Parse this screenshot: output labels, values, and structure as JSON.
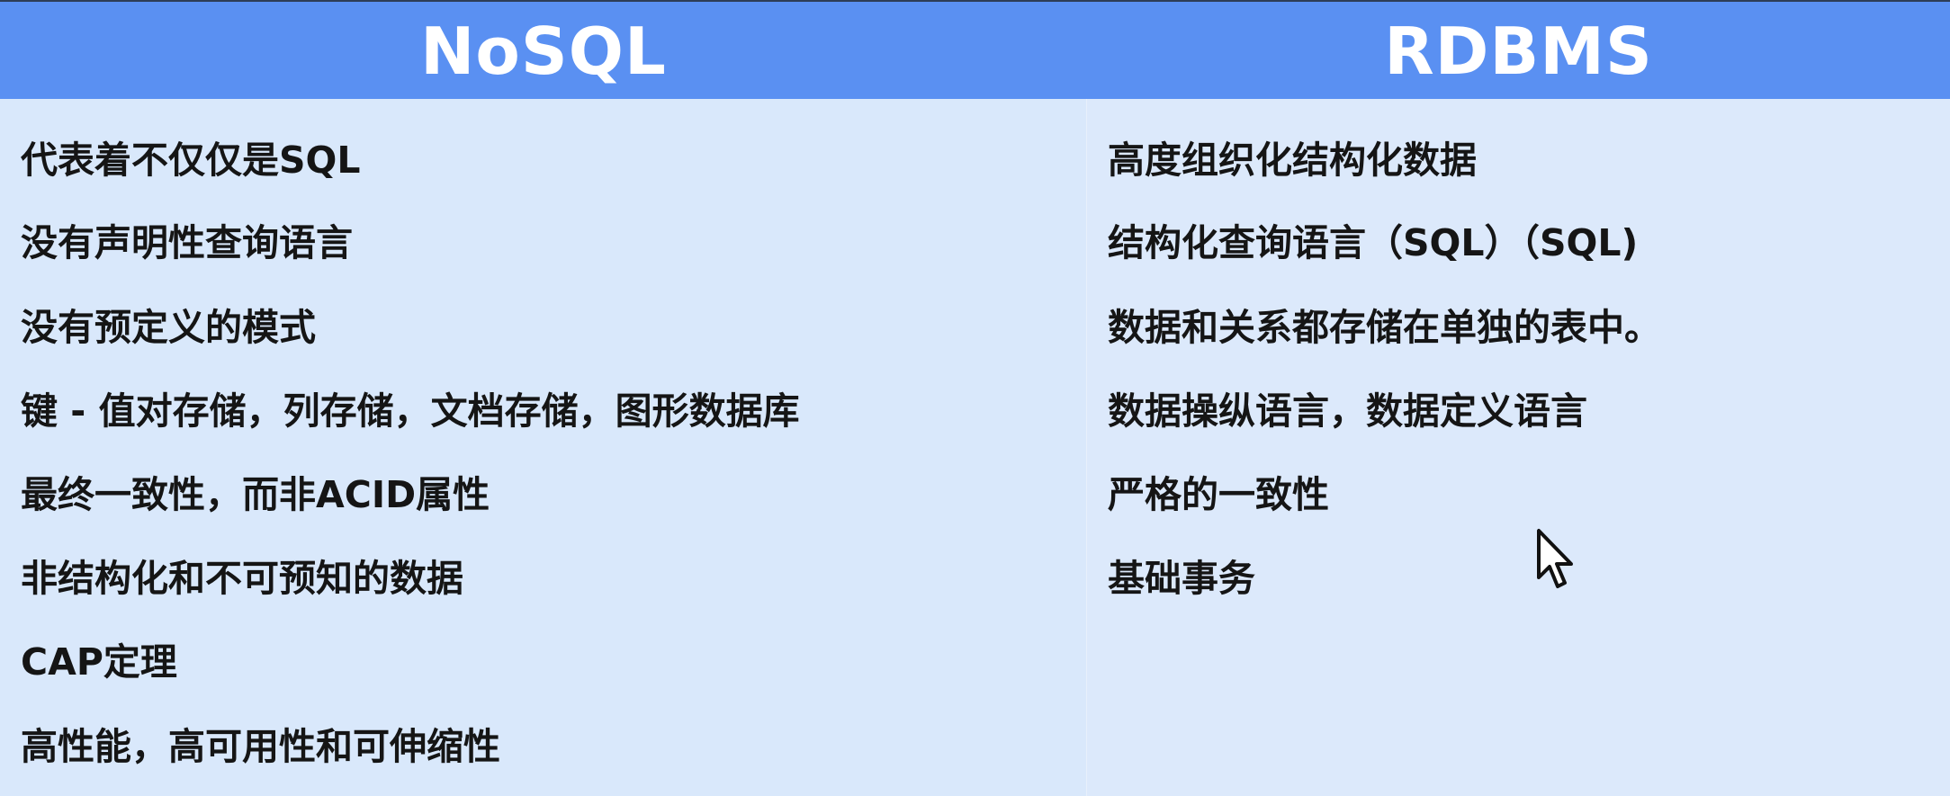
{
  "table": {
    "headers": {
      "left": "NoSQL",
      "right": "RDBMS"
    },
    "nosql_items": [
      "代表着不仅仅是SQL",
      "没有声明性查询语言",
      "没有预定义的模式",
      "键 - 值对存储，列存储，文档存储，图形数据库",
      "最终一致性，而非ACID属性",
      "非结构化和不可预知的数据",
      "CAP定理",
      "高性能，高可用性和可伸缩性"
    ],
    "rdbms_items": [
      "高度组织化结构化数据",
      "结构化查询语言（SQL）（SQL)",
      "数据和关系都存储在单独的表中。",
      "数据操纵语言，数据定义语言",
      "严格的一致性",
      "基础事务"
    ]
  },
  "colors": {
    "header_bg": "#5a90f2",
    "body_bg": "#d9e8fb",
    "text": "#151515",
    "header_text": "#ffffff"
  },
  "icons": {
    "cursor": "mouse-pointer-icon"
  }
}
